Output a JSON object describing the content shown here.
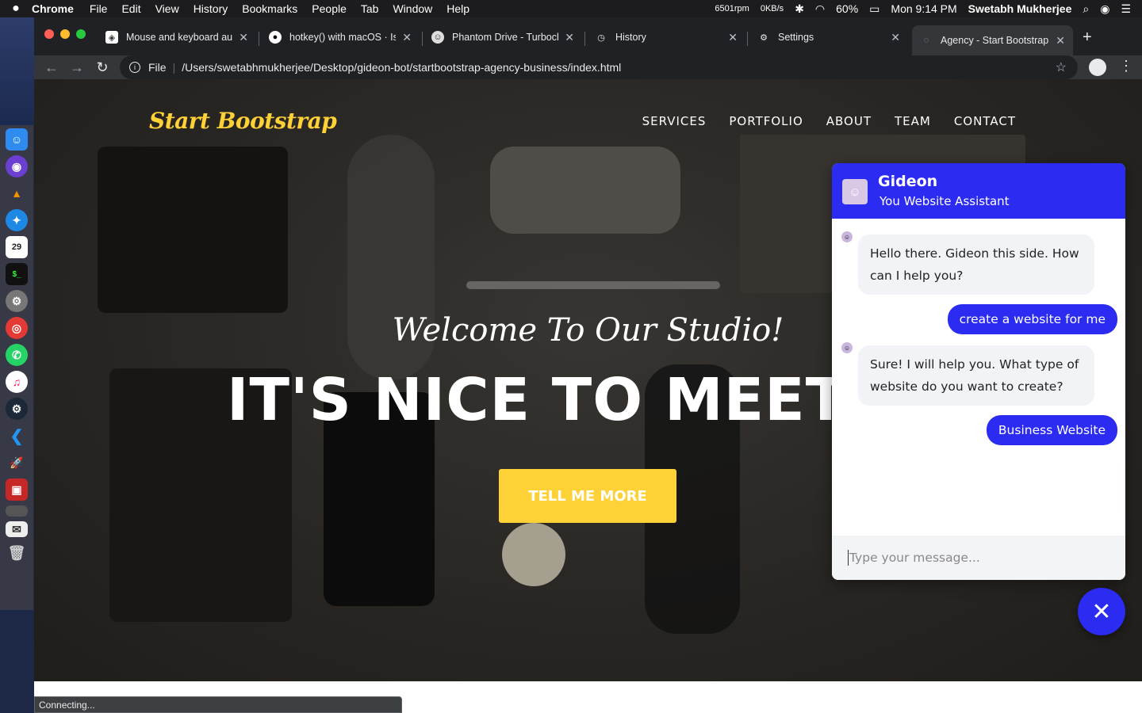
{
  "menubar": {
    "apple": "",
    "app": "Chrome",
    "menus": [
      "File",
      "Edit",
      "View",
      "History",
      "Bookmarks",
      "People",
      "Tab",
      "Window",
      "Help"
    ],
    "fan": "6501rpm",
    "net": "0KB/s",
    "battery": "60%",
    "clock": "Mon 9:14 PM",
    "user": "Swetabh  Mukherjee"
  },
  "tabs": [
    {
      "label": "Mouse and keyboard aut",
      "close": "✕"
    },
    {
      "label": "hotkey() with macOS · Is",
      "close": "✕"
    },
    {
      "label": "Phantom Drive - Turboch",
      "close": "✕"
    },
    {
      "label": "History",
      "close": "✕"
    },
    {
      "label": "Settings",
      "close": "✕"
    },
    {
      "label": "Agency - Start Bootstrap",
      "close": "✕"
    }
  ],
  "toolbar": {
    "scheme": "File",
    "url": "/Users/swetabhmukherjee/Desktop/gideon-bot/startbootstrap-agency-business/index.html"
  },
  "site": {
    "brand": "Start Bootstrap",
    "nav": [
      "SERVICES",
      "PORTFOLIO",
      "ABOUT",
      "TEAM",
      "CONTACT"
    ],
    "subheading": "Welcome To Our Studio!",
    "heading": "IT'S NICE TO MEET YOU",
    "cta": "TELL ME MORE"
  },
  "chat": {
    "name": "Gideon",
    "subtitle": "You Website Assistant",
    "messages": [
      {
        "from": "bot",
        "text": "Hello there. Gideon this side. How can I help you?"
      },
      {
        "from": "user",
        "text": "create a website for me"
      },
      {
        "from": "bot",
        "text": "Sure! I will help you. What type of website do you want to create?"
      },
      {
        "from": "user",
        "text": "Business Website"
      }
    ],
    "placeholder": "Type your message...",
    "close_glyph": "✕"
  },
  "status": "Connecting...",
  "colors": {
    "accent": "#fed136",
    "chat_primary": "#2b2bf2"
  }
}
